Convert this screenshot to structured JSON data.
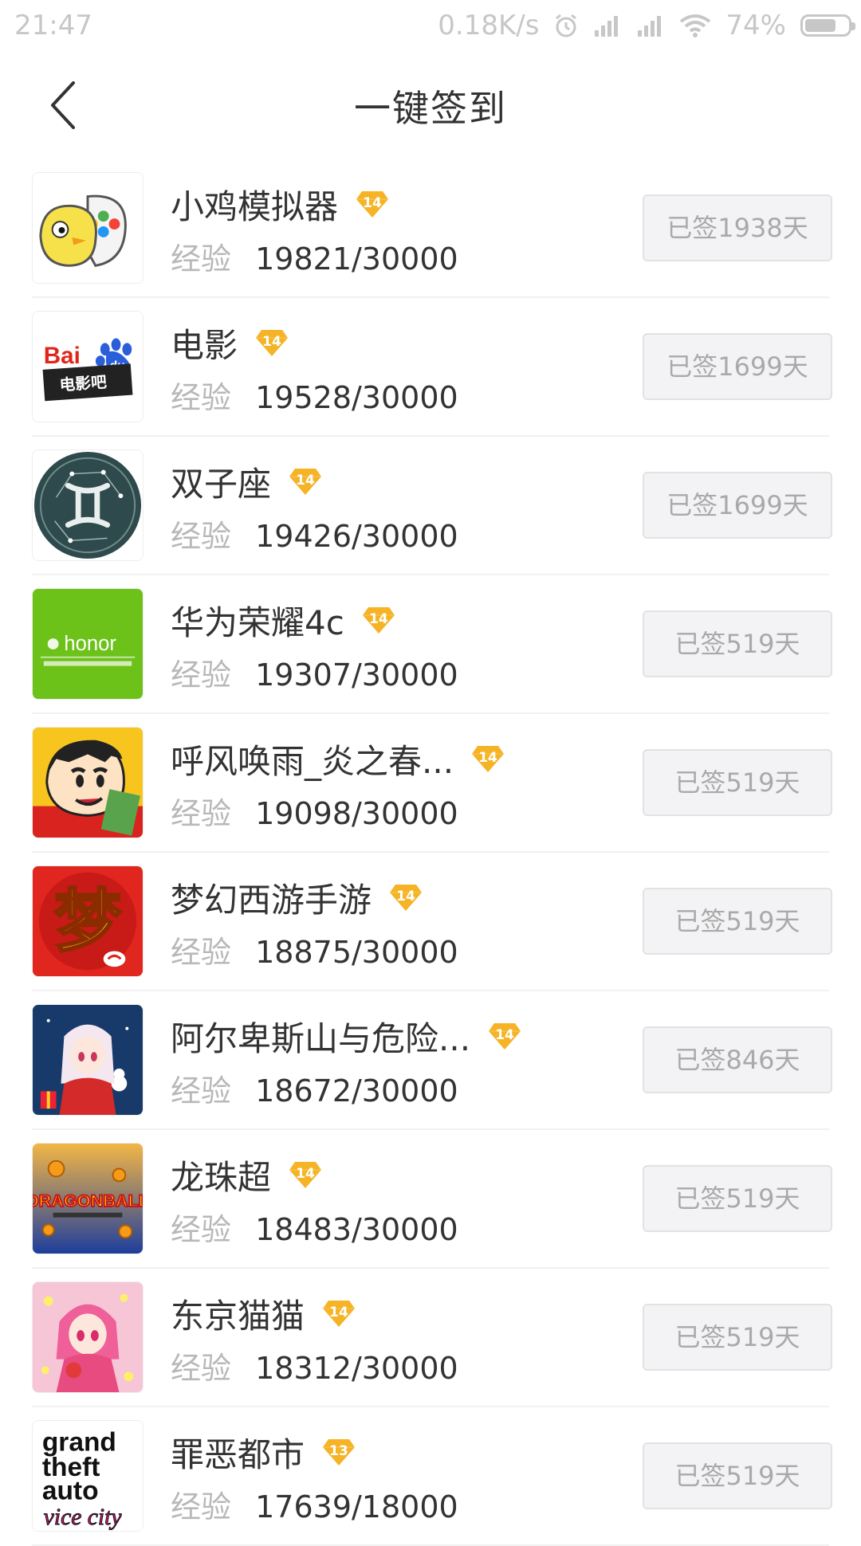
{
  "status_bar": {
    "time": "21:47",
    "net_speed": "0.18K/s",
    "battery": "74%",
    "battery_level": 0.74
  },
  "header": {
    "title": "一键签到"
  },
  "list": {
    "exp_label": "经验",
    "items": [
      {
        "name": "小鸡模拟器",
        "level": "14",
        "exp": "19821/30000",
        "status": "已签1938天",
        "icon": "xiaoji-emulator-icon"
      },
      {
        "name": "电影",
        "level": "14",
        "exp": "19528/30000",
        "status": "已签1699天",
        "icon": "baidu-movie-icon"
      },
      {
        "name": "双子座",
        "level": "14",
        "exp": "19426/30000",
        "status": "已签1699天",
        "icon": "gemini-icon"
      },
      {
        "name": "华为荣耀4c",
        "level": "14",
        "exp": "19307/30000",
        "status": "已签519天",
        "icon": "honor-icon"
      },
      {
        "name": "呼风唤雨_炎之春...",
        "level": "14",
        "exp": "19098/30000",
        "status": "已签519天",
        "icon": "crayon-shin-chan-icon"
      },
      {
        "name": "梦幻西游手游",
        "level": "14",
        "exp": "18875/30000",
        "status": "已签519天",
        "icon": "menghuan-xiyou-icon"
      },
      {
        "name": "阿尔卑斯山与危险...",
        "level": "14",
        "exp": "18672/30000",
        "status": "已签846天",
        "icon": "anime-girl-icon"
      },
      {
        "name": "龙珠超",
        "level": "14",
        "exp": "18483/30000",
        "status": "已签519天",
        "icon": "dragon-ball-icon"
      },
      {
        "name": "东京猫猫",
        "level": "14",
        "exp": "18312/30000",
        "status": "已签519天",
        "icon": "tokyo-mew-mew-icon"
      },
      {
        "name": "罪恶都市",
        "level": "13",
        "exp": "17639/18000",
        "status": "已签519天",
        "icon": "gta-vice-city-icon"
      }
    ]
  },
  "colors": {
    "badge": "#f5b325",
    "signed_bg": "#f3f3f5",
    "signed_text": "#a9a9a9",
    "muted": "#b8b8b8"
  },
  "icons": [
    "back-arrow-icon",
    "alarm-icon",
    "signal-icon",
    "wifi-icon",
    "battery-icon",
    "level-diamond-icon"
  ]
}
